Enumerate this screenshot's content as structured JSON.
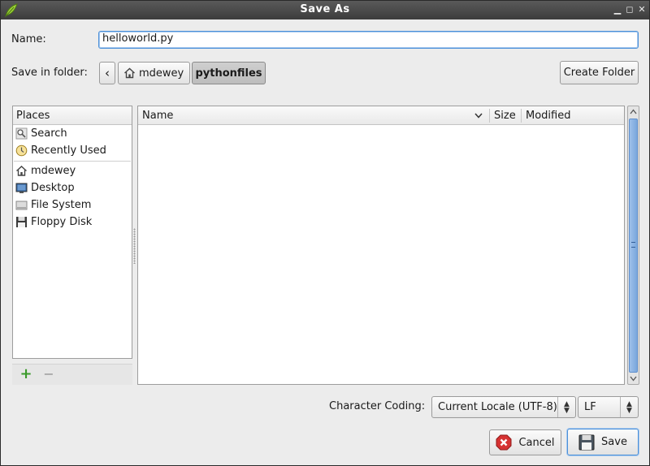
{
  "window": {
    "title": "Save As"
  },
  "name_row": {
    "label": "Name:",
    "value": "helloworld.py"
  },
  "folder_row": {
    "label": "Save in folder:",
    "back_glyph": "‹",
    "crumbs": [
      "mdewey",
      "pythonfiles"
    ],
    "create_folder": "Create Folder"
  },
  "places": {
    "header": "Places",
    "group1": [
      {
        "label": "Search",
        "icon": "search-icon"
      },
      {
        "label": "Recently Used",
        "icon": "clock-icon"
      }
    ],
    "group2": [
      {
        "label": "mdewey",
        "icon": "home-icon"
      },
      {
        "label": "Desktop",
        "icon": "desktop-icon"
      },
      {
        "label": "File System",
        "icon": "drive-icon"
      },
      {
        "label": "Floppy Disk",
        "icon": "floppy-icon"
      }
    ],
    "add_glyph": "+",
    "remove_glyph": "−"
  },
  "files": {
    "columns": {
      "name": "Name",
      "size": "Size",
      "modified": "Modified"
    },
    "rows": []
  },
  "encoding": {
    "label": "Character Coding:",
    "value": "Current Locale (UTF-8)",
    "line_ending": "LF"
  },
  "actions": {
    "cancel": "Cancel",
    "save": "Save"
  },
  "colors": {
    "accent": "#4a90d9",
    "cancel_red": "#d63232",
    "add_green": "#3a9a2a"
  }
}
